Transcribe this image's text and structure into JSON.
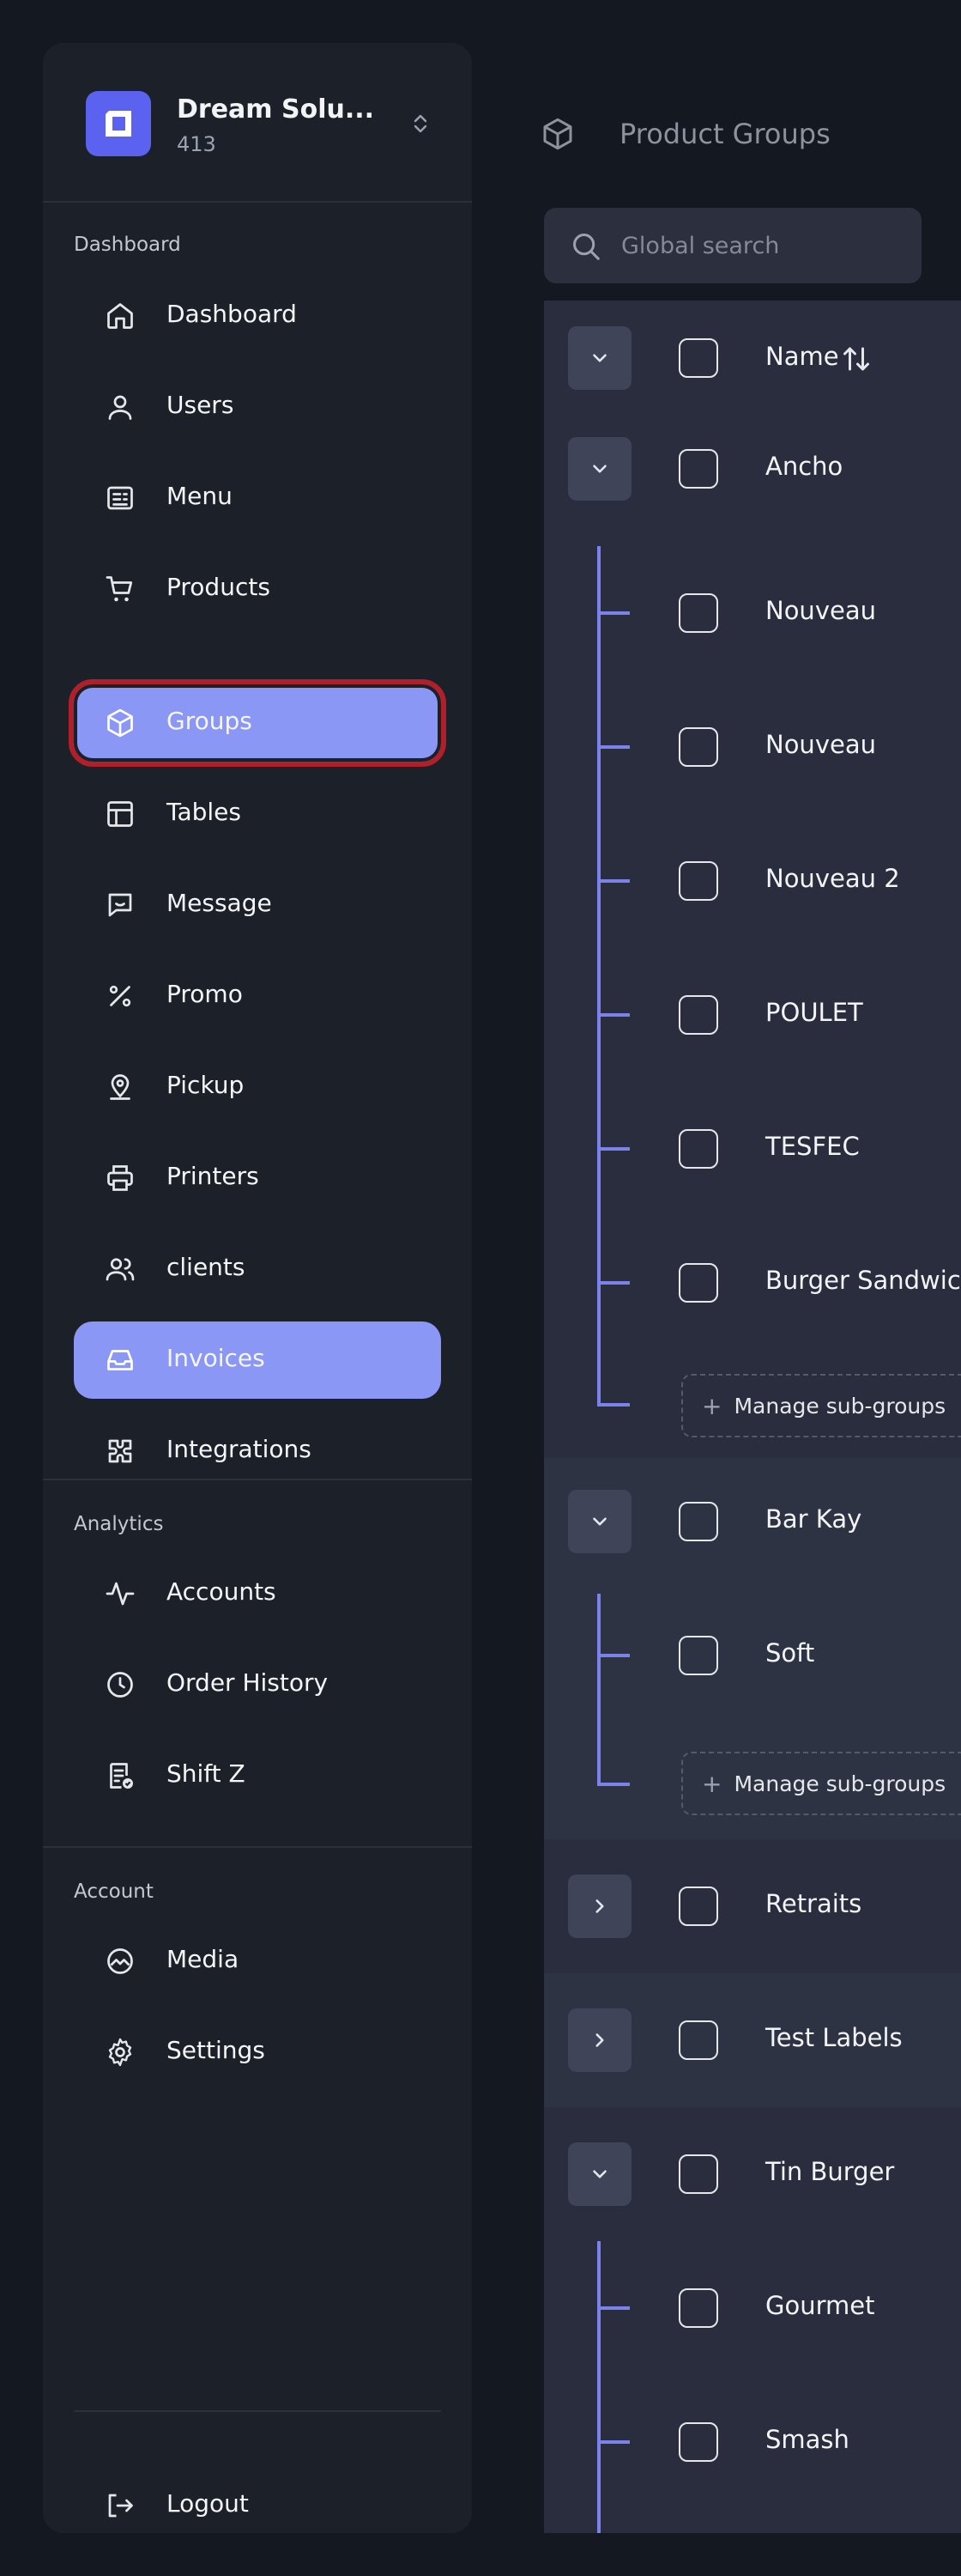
{
  "brand": {
    "name": "Dream Solu...",
    "sub": "413"
  },
  "sidebar": {
    "sections": [
      {
        "label": "Dashboard"
      },
      {
        "label": "Analytics"
      },
      {
        "label": "Account"
      }
    ],
    "items": [
      {
        "label": "Dashboard",
        "icon": "home-icon"
      },
      {
        "label": "Users",
        "icon": "user-icon"
      },
      {
        "label": "Menu",
        "icon": "menu-icon"
      },
      {
        "label": "Products",
        "icon": "cart-icon"
      },
      {
        "label": "Groups",
        "icon": "box-icon"
      },
      {
        "label": "Tables",
        "icon": "table-icon"
      },
      {
        "label": "Message",
        "icon": "message-icon"
      },
      {
        "label": "Promo",
        "icon": "percent-icon"
      },
      {
        "label": "Pickup",
        "icon": "location-icon"
      },
      {
        "label": "Printers",
        "icon": "printer-icon"
      },
      {
        "label": "clients",
        "icon": "users-icon"
      },
      {
        "label": "Invoices",
        "icon": "inbox-icon"
      },
      {
        "label": "Integrations",
        "icon": "puzzle-icon"
      },
      {
        "label": "Accounts",
        "icon": "activity-icon"
      },
      {
        "label": "Order History",
        "icon": "clock-icon"
      },
      {
        "label": "Shift Z",
        "icon": "receipt-check-icon"
      },
      {
        "label": "Media",
        "icon": "image-icon"
      },
      {
        "label": "Settings",
        "icon": "gear-icon"
      }
    ],
    "logout": "Logout"
  },
  "main": {
    "title": "Product Groups",
    "search_placeholder": "Global search",
    "column_name": "Name",
    "manage_label": "Manage sub-groups",
    "groups": [
      {
        "name": "Ancho",
        "expanded": true,
        "children": [
          "Nouveau",
          "Nouveau",
          "Nouveau 2",
          "POULET",
          "TESFEC",
          "Burger Sandwiche"
        ]
      },
      {
        "name": "Bar Kay",
        "expanded": true,
        "children": [
          "Soft"
        ]
      },
      {
        "name": "Retraits",
        "expanded": false,
        "children": []
      },
      {
        "name": "Test Labels",
        "expanded": false,
        "children": []
      },
      {
        "name": "Tin Burger",
        "expanded": true,
        "children": [
          "Gourmet",
          "Smash"
        ]
      }
    ]
  },
  "colors": {
    "accent": "#8a97f5",
    "brand": "#5b62ef",
    "selection_outline": "#b0202a",
    "tree_line": "#7b83ea"
  }
}
